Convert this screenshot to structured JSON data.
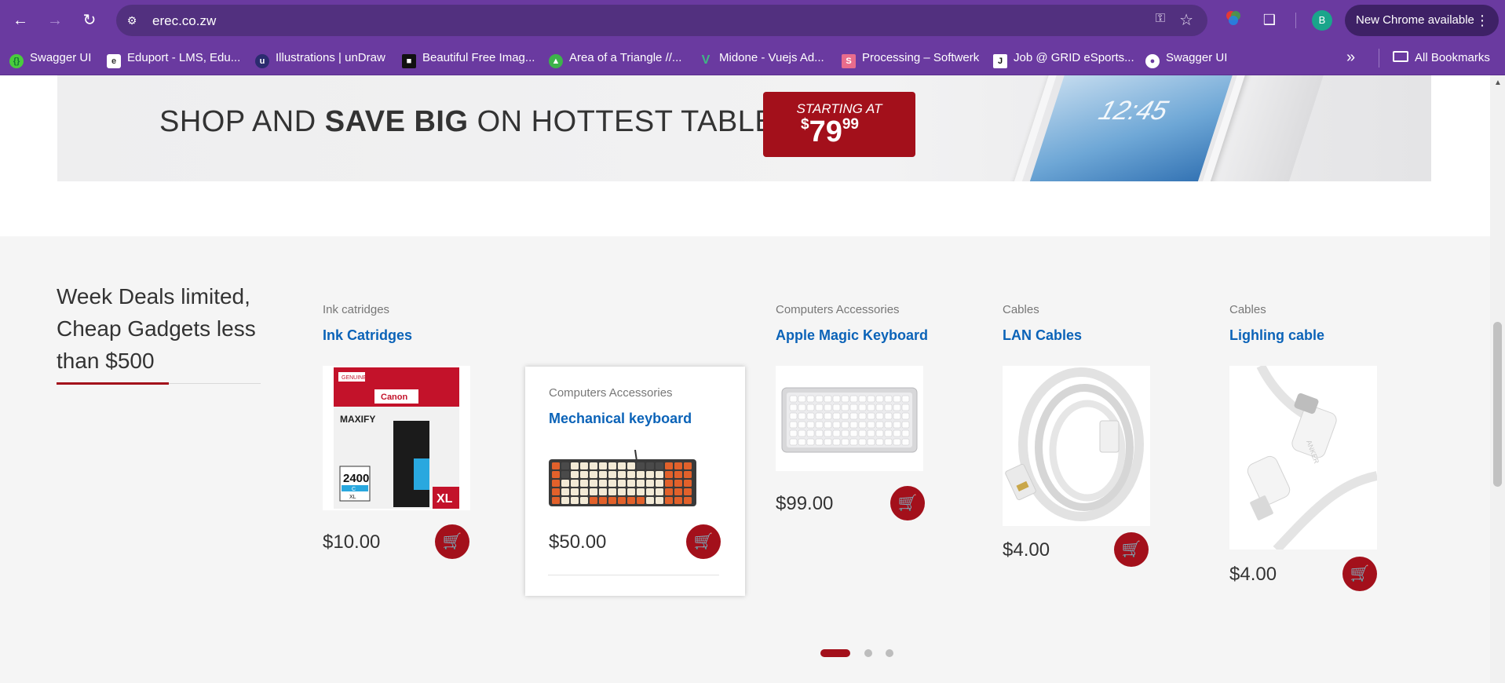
{
  "browser": {
    "url": "erec.co.zw",
    "update_label": "New Chrome available",
    "profile_initial": "B",
    "bookmarks": [
      {
        "label": "Swagger UI",
        "icon": "swagger-icon",
        "color": "#49cc3c"
      },
      {
        "label": "Eduport - LMS, Edu...",
        "icon": "eduport-icon",
        "color": "#ffffff"
      },
      {
        "label": "Illustrations | unDraw",
        "icon": "undraw-icon",
        "color": "#ffffff"
      },
      {
        "label": "Beautiful Free Imag...",
        "icon": "unsplash-icon",
        "color": "#111111"
      },
      {
        "label": "Area of a Triangle //...",
        "icon": "math-icon",
        "color": "#3db34a"
      },
      {
        "label": "Midone - Vuejs Ad...",
        "icon": "vue-icon",
        "color": "#3fb884"
      },
      {
        "label": "Processing – Softwerk",
        "icon": "softwerk-icon",
        "color": "#e86c8c"
      },
      {
        "label": "Job @ GRID eSports...",
        "icon": "grid-icon",
        "color": "#ffffff"
      },
      {
        "label": "Swagger UI",
        "icon": "globe-icon",
        "color": "#ffffff"
      }
    ],
    "all_bookmarks": "All Bookmarks"
  },
  "banner": {
    "headline_pre": "SHOP AND ",
    "headline_bold": "SAVE BIG",
    "headline_post": " ON HOTTEST TABLETS",
    "starting_at": "STARTING AT",
    "currency": "$",
    "price_main": "79",
    "price_cents": "99",
    "tablet_clock": "12:45"
  },
  "deals": {
    "title": "Week Deals limited, Cheap Gadgets less than $500",
    "products": [
      {
        "category": "Ink catridges",
        "name": "Ink Catridges",
        "price": "$10.00",
        "image": "ink-cartridge-image"
      },
      {
        "category": "Computers Accessories",
        "name": "Mechanical keyboard",
        "price": "$50.00",
        "image": "mechanical-keyboard-image"
      },
      {
        "category": "Computers Accessories",
        "name": "Apple Magic Keyboard",
        "price": "$99.00",
        "image": "magic-keyboard-image"
      },
      {
        "category": "Cables",
        "name": "LAN Cables",
        "price": "$4.00",
        "image": "lan-cable-image"
      },
      {
        "category": "Cables",
        "name": "Lighling cable",
        "price": "$4.00",
        "image": "lightning-cable-image"
      }
    ],
    "carousel_pages": 3,
    "active_page": 1
  },
  "product_image_text": {
    "canon_brand": "Canon",
    "genuine": "GENUINE",
    "maxify": "MAXIFY",
    "model": "2400",
    "color_code": "C",
    "size_small": "XL",
    "size_badge": "XL",
    "anker": "ANKER"
  },
  "colors": {
    "accent": "#a3101b",
    "link": "#0b63b8",
    "browser_chrome": "#6a3aa0"
  }
}
